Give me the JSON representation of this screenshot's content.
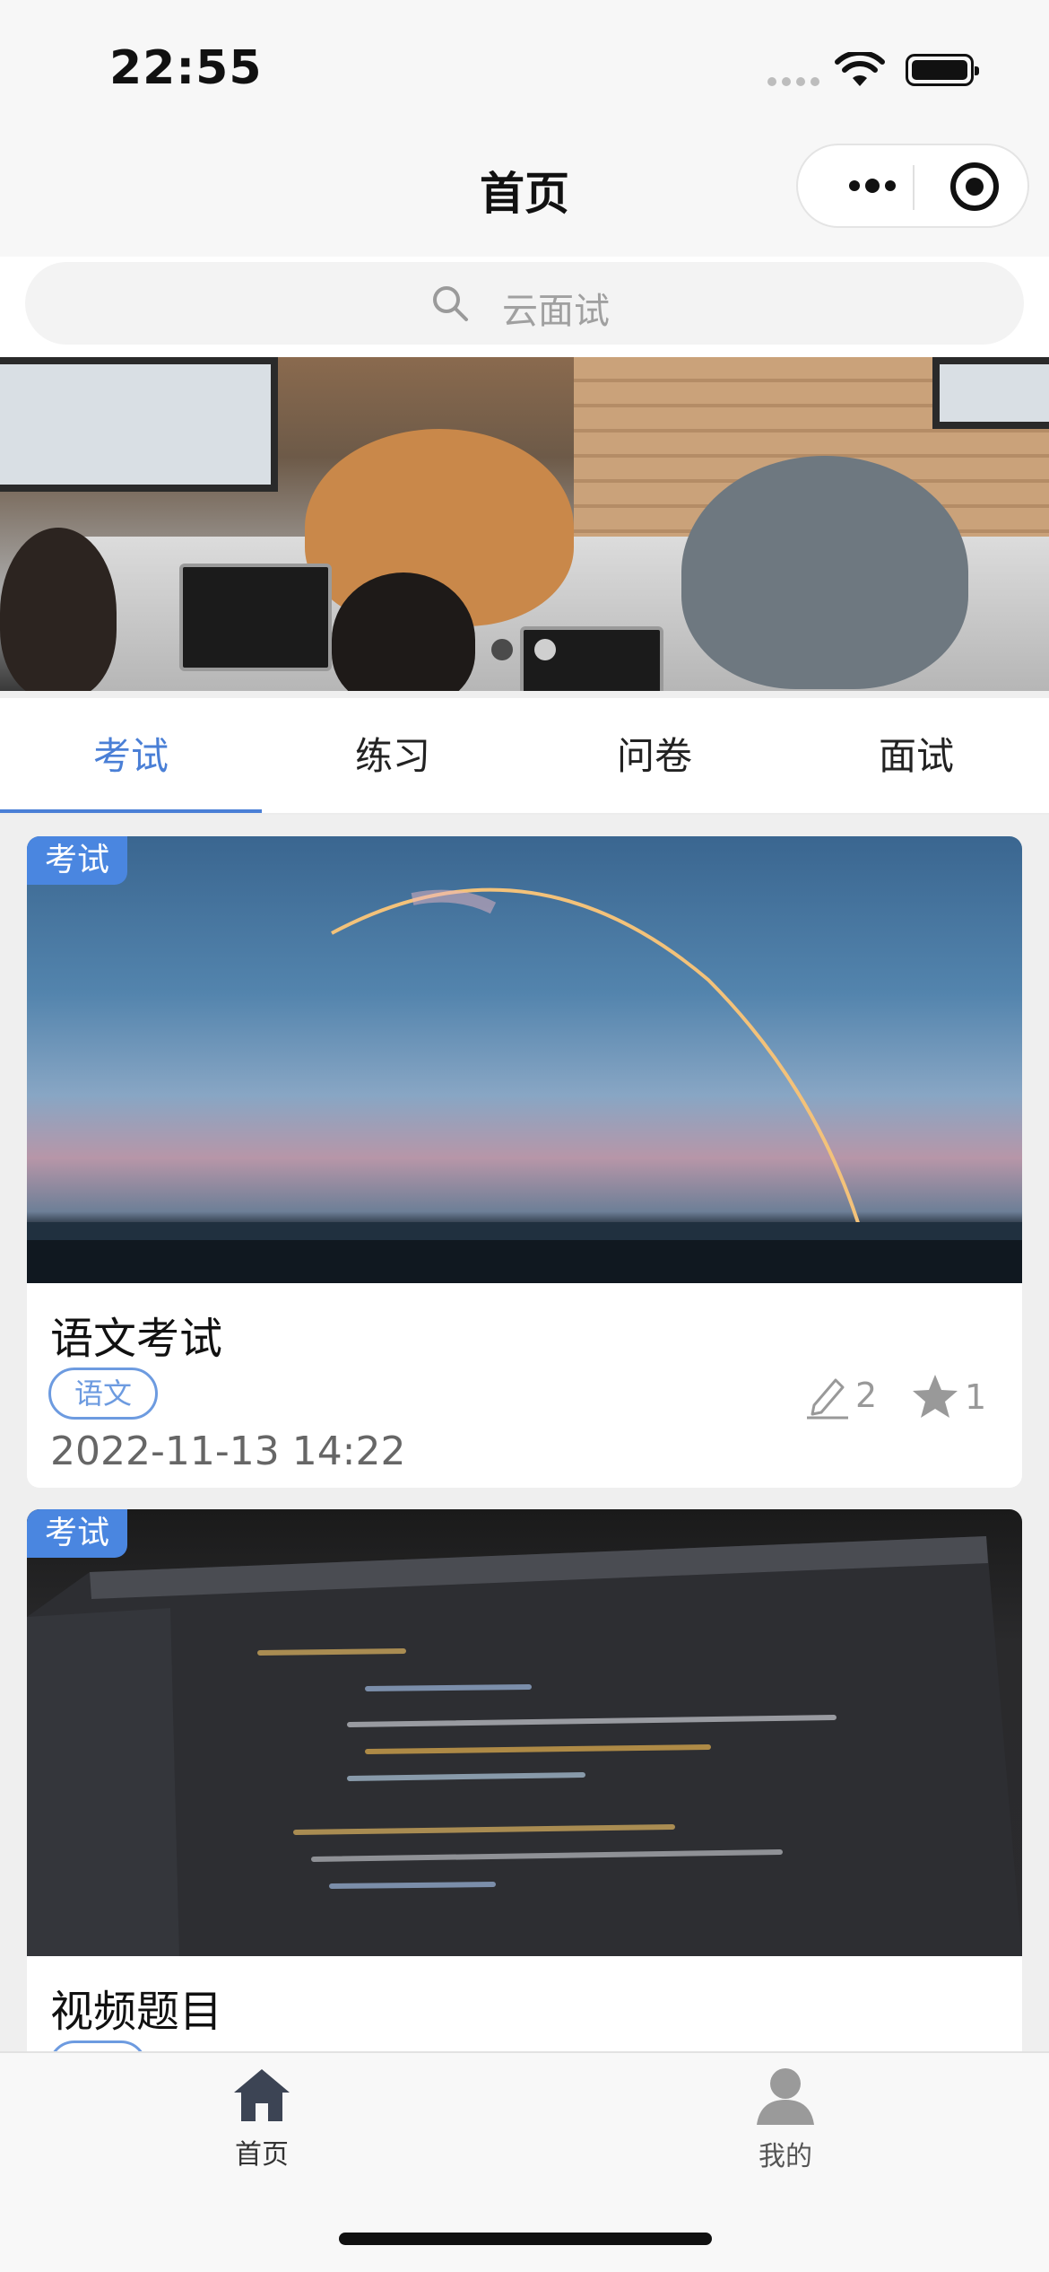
{
  "status_bar": {
    "time": "22:55"
  },
  "header": {
    "title": "首页"
  },
  "search": {
    "placeholder": "云面试"
  },
  "banner": {
    "dot_count": 2,
    "active_index": 0
  },
  "tabs": [
    {
      "label": "考试",
      "active": true
    },
    {
      "label": "练习",
      "active": false
    },
    {
      "label": "问卷",
      "active": false
    },
    {
      "label": "面试",
      "active": false
    }
  ],
  "cards": [
    {
      "badge": "考试",
      "title": "语文考试",
      "tag": "语文",
      "date": "2022-11-13 14:22",
      "edit_count": "2",
      "star_count": "1",
      "cover": "rocket-launch-photo"
    },
    {
      "badge": "考试",
      "title": "视频题目",
      "cover": "code-laptop-photo"
    }
  ],
  "tabbar": [
    {
      "label": "首页",
      "icon": "home-icon",
      "active": true
    },
    {
      "label": "我的",
      "icon": "user-icon",
      "active": false
    }
  ],
  "colors": {
    "accent": "#4a7fd6",
    "badge": "#4a86e0",
    "tag": "#6d9be0"
  }
}
